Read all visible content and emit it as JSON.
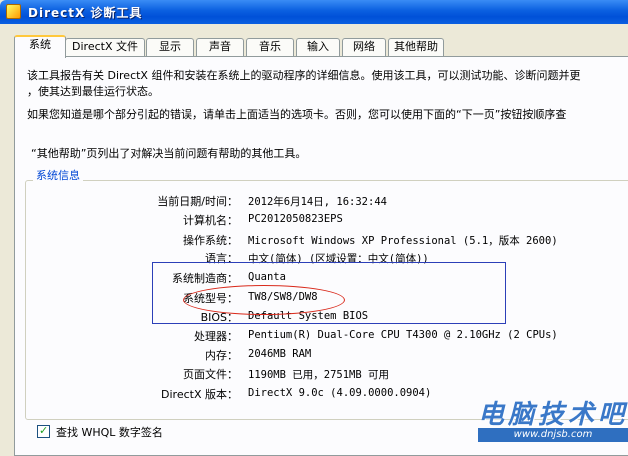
{
  "window": {
    "title": "DirectX 诊断工具"
  },
  "tabs": [
    "系统",
    "DirectX 文件",
    "显示",
    "声音",
    "音乐",
    "输入",
    "网络",
    "其他帮助"
  ],
  "intro": {
    "line1": "该工具报告有关 DirectX 组件和安装在系统上的驱动程序的详细信息。使用该工具，可以测试功能、诊断问题并更",
    "line2": "，使其达到最佳运行状态。",
    "line3": "如果您知道是哪个部分引起的错误，请单击上面适当的选项卡。否则，您可以使用下面的“下一页”按钮按顺序查",
    "line4": "“其他帮助”页列出了对解决当前问题有帮助的其他工具。"
  },
  "system_info": {
    "group_label": "系统信息",
    "rows": [
      {
        "label": "当前日期/时间：",
        "value": "2012年6月14日, 16:32:44"
      },
      {
        "label": "计算机名：",
        "value": "PC2012050823EPS"
      },
      {
        "label": "操作系统：",
        "value": "Microsoft Windows XP Professional (5.1，版本 2600)"
      },
      {
        "label": "语言：",
        "value": "中文(简体) (区域设置：中文(简体))"
      },
      {
        "label": "系统制造商：",
        "value": "Quanta"
      },
      {
        "label": "系统型号：",
        "value": "TW8/SW8/DW8"
      },
      {
        "label": "BIOS：",
        "value": "Default System BIOS"
      },
      {
        "label": "处理器：",
        "value": "Pentium(R) Dual-Core CPU       T4300  @ 2.10GHz (2 CPUs)"
      },
      {
        "label": "内存：",
        "value": "2046MB RAM"
      },
      {
        "label": "页面文件：",
        "value": "1190MB 已用，2751MB 可用"
      },
      {
        "label": "DirectX 版本：",
        "value": "DirectX 9.0c (4.09.0000.0904)"
      }
    ]
  },
  "whql_check": {
    "label": "查找 WHQL 数字签名",
    "checked": true
  },
  "watermark": {
    "text": "电脑技术吧",
    "url": "www.dnjsb.com"
  },
  "colors": {
    "annotation_box": "#2c3fb8",
    "annotation_ellipse": "#d92a1c"
  }
}
